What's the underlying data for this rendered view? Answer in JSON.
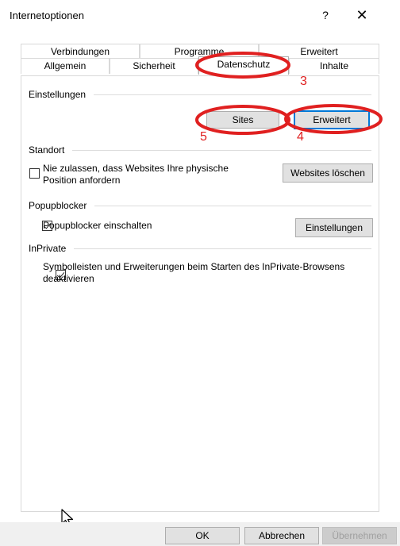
{
  "window": {
    "title": "Internetoptionen",
    "help_glyph": "?",
    "close_glyph": "✕"
  },
  "tabs": {
    "back_row": [
      "Verbindungen",
      "Programme",
      "Erweitert"
    ],
    "front_row": [
      "Allgemein",
      "Sicherheit",
      "Datenschutz",
      "Inhalte"
    ],
    "active": "Datenschutz"
  },
  "einstellungen": {
    "heading": "Einstellungen",
    "sites_button": "Sites",
    "erweitert_button": "Erweitert"
  },
  "standort": {
    "heading": "Standort",
    "checkbox_label_line1": "Nie zulassen, dass Websites Ihre physische",
    "checkbox_label_line2": "Position anfordern",
    "checked": false,
    "clear_button": "Websites löschen"
  },
  "popupblocker": {
    "heading": "Popupblocker",
    "checkbox_label": "Popupblocker einschalten",
    "checked": true,
    "settings_button": "Einstellungen"
  },
  "inprivate": {
    "heading": "InPrivate",
    "checkbox_label_line1": "Symbolleisten und Erweiterungen beim Starten des InPrivate-Browsens",
    "checkbox_label_line2": "deaktivieren",
    "checked": true
  },
  "footer": {
    "ok": "OK",
    "cancel": "Abbrechen",
    "apply": "Übernehmen"
  },
  "annotations": {
    "color": "#e02020",
    "tab_number": "3",
    "erweitert_number": "4",
    "sites_number": "5"
  }
}
